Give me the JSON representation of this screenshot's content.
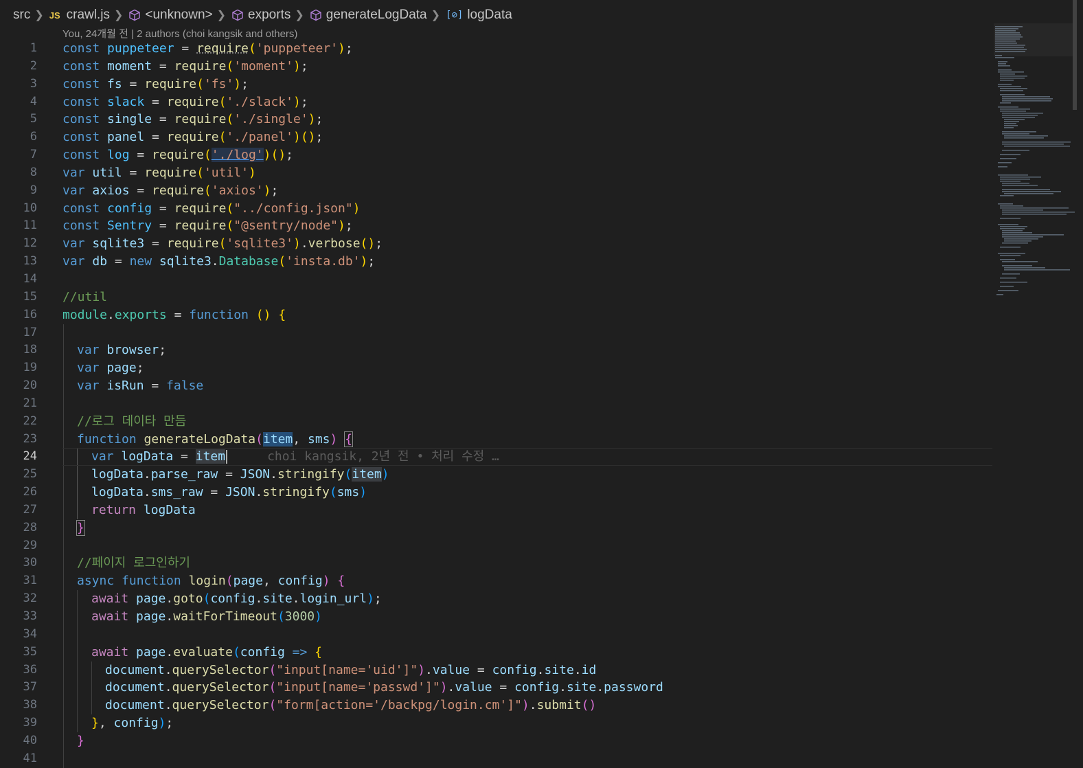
{
  "breadcrumb": {
    "items": [
      "src",
      "crawl.js",
      "<unknown>",
      "exports",
      "generateLogData",
      "logData"
    ],
    "js_badge": "JS"
  },
  "codelens": "You, 24개월 전 | 2 authors (choi kangsik and others)",
  "editor": {
    "active_line": 24,
    "blame": "choi kangsik, 2년 전 • 처리 수정 …",
    "line_numbers": [
      "1",
      "2",
      "3",
      "4",
      "5",
      "6",
      "7",
      "8",
      "9",
      "10",
      "11",
      "12",
      "13",
      "14",
      "15",
      "16",
      "17",
      "18",
      "19",
      "20",
      "21",
      "22",
      "23",
      "24",
      "25",
      "26",
      "27",
      "28",
      "29",
      "30",
      "31",
      "32",
      "33",
      "34",
      "35",
      "36",
      "37",
      "38",
      "39",
      "40",
      "41"
    ],
    "t": {
      "const": "const",
      "var": "var",
      "eq": " = ",
      "require": "require",
      "semi": ";",
      "lp": "(",
      "rp": ")",
      "lb": "{",
      "rb": "}",
      "comma": ", ",
      "dot": ".",
      "sp": " ",
      "function": "function",
      "async": "async",
      "await": "await",
      "return": "return",
      "new": "new",
      "false": "false",
      "arrow": " => ",
      "puppeteer": "puppeteer",
      "s_puppeteer": "'puppeteer'",
      "moment": "moment",
      "s_moment": "'moment'",
      "fs": "fs",
      "s_fs": "'fs'",
      "slack": "slack",
      "s_slack": "'./slack'",
      "single": "single",
      "s_single": "'./single'",
      "panel": "panel",
      "s_panel": "'./panel'",
      "log": "log",
      "s_log": "'./log'",
      "util": "util",
      "s_util": "'util'",
      "axios": "axios",
      "s_axios": "'axios'",
      "config": "config",
      "s_config": "\"../config.json\"",
      "Sentry": "Sentry",
      "s_sentry": "\"@sentry/node\"",
      "sqlite3": "sqlite3",
      "s_sqlite3": "'sqlite3'",
      "verbose": "verbose",
      "db": "db",
      "Database": "Database",
      "s_insta": "'insta.db'",
      "c_util": "//util",
      "module": "module",
      "exports": "exports",
      "browser": "browser",
      "page": "page",
      "isRun": "isRun",
      "c_log": "//로그 데이타 만듬",
      "generateLogData": "generateLogData",
      "item": "item",
      "sms": "sms",
      "logData": "logData",
      "parse_raw": "parse_raw",
      "sms_raw": "sms_raw",
      "JSON": "JSON",
      "stringify": "stringify",
      "c_login": "//페이지 로그인하기",
      "login": "login",
      "goto": "goto",
      "site": "site",
      "login_url": "login_url",
      "waitForTimeout": "waitForTimeout",
      "n3000": "3000",
      "evaluate": "evaluate",
      "document": "document",
      "querySelector": "querySelector",
      "s_uid": "\"input[name='uid']\"",
      "value": "value",
      "id": "id",
      "s_passwd": "\"input[name='passwd']\"",
      "password": "password",
      "s_form": "\"form[action='/backpg/login.cm']\"",
      "submit": "submit"
    }
  },
  "colors": {
    "background": "#1f1f1f",
    "keyword": "#569cd6",
    "control": "#c586c0",
    "string": "#ce9178",
    "function": "#dcdcaa",
    "comment": "#6a9955"
  },
  "icons": [
    "js-file-icon",
    "symbol-namespace-icon",
    "symbol-field-icon",
    "chevron-right-icon"
  ]
}
